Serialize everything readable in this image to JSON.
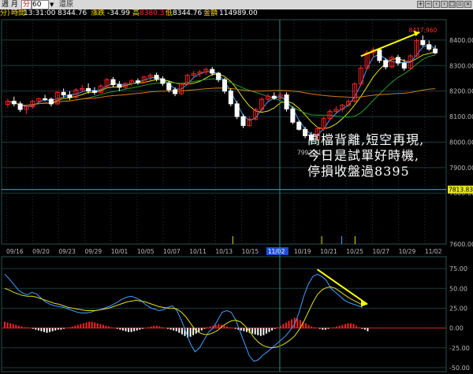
{
  "header": {
    "menu_label": "週 月",
    "period_tab": "分",
    "period_value": "60",
    "toolbar_extra": "還原",
    "row2_prefix": "分)",
    "time_label": "時間",
    "time_value": "13:31:00",
    "close_value": "8344.76",
    "change_label": "漲跌",
    "change_value": "-34.99",
    "high_label": "高",
    "high_value": "8380.3",
    "low_label": "低",
    "low_value": "8344.76",
    "amount_label": "金額",
    "amount_value": "114989.00"
  },
  "colors": {
    "up": "#ff2020",
    "down": "#ffffff",
    "ma_fast": "#3fa0ff",
    "ma_mid": "#e0e020",
    "ma_slow": "#2a9a2a",
    "ma_long": "#d07a20",
    "current_line": "#00d0d0",
    "hist_up": "#ff2020",
    "hist_down": "#ffffff",
    "macd_dif": "#3fa0ff",
    "macd_dea": "#e0e020",
    "arrow": "#ffff00",
    "grid": "#1e3a3a",
    "axis": "#bbbbbb"
  },
  "annotations": {
    "comment_lines": [
      "高檔背離,短空再現,",
      "今日是試單好時機,",
      "停損收盤過8395"
    ],
    "low_label": "7992.810",
    "high_label": "8417.960",
    "current_price_label": "7813.830"
  },
  "chart_data": [
    {
      "type": "candlestick",
      "name": "price",
      "ylim": [
        7600,
        8480
      ],
      "y_ticks": [
        "8400.00",
        "8300.00",
        "8200.00",
        "8100.00",
        "8000.00",
        "7900.00",
        "7800.00",
        "7600.00"
      ],
      "x_tick_labels": [
        "09/16",
        "09/20",
        "09/23",
        "09/29",
        "10/01",
        "10/05",
        "10/07",
        "10/11",
        "10/13",
        "10/15",
        "11/02",
        "10/19",
        "10/21",
        "10/25",
        "10/27",
        "10/29",
        "11/02"
      ],
      "highlighted_tick": "11/02",
      "candles": [
        [
          8148,
          8170,
          8135,
          8160
        ],
        [
          8160,
          8178,
          8140,
          8150
        ],
        [
          8150,
          8160,
          8118,
          8128
        ],
        [
          8128,
          8142,
          8110,
          8138
        ],
        [
          8138,
          8165,
          8130,
          8160
        ],
        [
          8160,
          8175,
          8150,
          8170
        ],
        [
          8170,
          8185,
          8160,
          8168
        ],
        [
          8168,
          8175,
          8140,
          8150
        ],
        [
          8150,
          8200,
          8145,
          8195
        ],
        [
          8195,
          8210,
          8175,
          8185
        ],
        [
          8185,
          8200,
          8165,
          8175
        ],
        [
          8175,
          8212,
          8170,
          8205
        ],
        [
          8205,
          8225,
          8195,
          8210
        ],
        [
          8210,
          8230,
          8190,
          8200
        ],
        [
          8200,
          8215,
          8185,
          8195
        ],
        [
          8195,
          8228,
          8190,
          8220
        ],
        [
          8220,
          8252,
          8210,
          8245
        ],
        [
          8245,
          8255,
          8215,
          8225
        ],
        [
          8225,
          8240,
          8200,
          8215
        ],
        [
          8215,
          8235,
          8205,
          8230
        ],
        [
          8230,
          8248,
          8220,
          8240
        ],
        [
          8240,
          8250,
          8225,
          8235
        ],
        [
          8235,
          8260,
          8230,
          8255
        ],
        [
          8255,
          8270,
          8240,
          8262
        ],
        [
          8262,
          8272,
          8238,
          8248
        ],
        [
          8248,
          8258,
          8220,
          8230
        ],
        [
          8230,
          8240,
          8195,
          8205
        ],
        [
          8205,
          8215,
          8180,
          8190
        ],
        [
          8190,
          8232,
          8185,
          8228
        ],
        [
          8228,
          8268,
          8222,
          8262
        ],
        [
          8262,
          8280,
          8250,
          8268
        ],
        [
          8268,
          8283,
          8255,
          8275
        ],
        [
          8275,
          8292,
          8265,
          8285
        ],
        [
          8285,
          8295,
          8260,
          8270
        ],
        [
          8270,
          8276,
          8235,
          8245
        ],
        [
          8245,
          8252,
          8190,
          8200
        ],
        [
          8200,
          8210,
          8140,
          8150
        ],
        [
          8150,
          8162,
          8090,
          8100
        ],
        [
          8100,
          8110,
          8055,
          8065
        ],
        [
          8065,
          8098,
          8060,
          8090
        ],
        [
          8090,
          8135,
          8085,
          8128
        ],
        [
          8128,
          8175,
          8120,
          8168
        ],
        [
          8168,
          8190,
          8160,
          8180
        ],
        [
          8180,
          8195,
          8165,
          8172
        ],
        [
          8172,
          8195,
          8168,
          8185
        ],
        [
          8185,
          8195,
          8120,
          8130
        ],
        [
          8130,
          8140,
          8070,
          8078
        ],
        [
          8078,
          8085,
          8045,
          8050
        ],
        [
          8050,
          8060,
          8015,
          8025
        ],
        [
          8025,
          8040,
          7993,
          8010
        ],
        [
          8010,
          8060,
          8005,
          8052
        ],
        [
          8052,
          8100,
          8045,
          8092
        ],
        [
          8092,
          8128,
          8085,
          8120
        ],
        [
          8120,
          8140,
          8110,
          8128
        ],
        [
          8128,
          8150,
          8118,
          8145
        ],
        [
          8145,
          8168,
          8138,
          8160
        ],
        [
          8160,
          8235,
          8155,
          8228
        ],
        [
          8228,
          8300,
          8220,
          8290
        ],
        [
          8290,
          8360,
          8282,
          8350
        ],
        [
          8350,
          8372,
          8330,
          8362
        ],
        [
          8362,
          8368,
          8310,
          8320
        ],
        [
          8320,
          8330,
          8285,
          8295
        ],
        [
          8295,
          8340,
          8288,
          8332
        ],
        [
          8332,
          8342,
          8300,
          8310
        ],
        [
          8310,
          8325,
          8280,
          8290
        ],
        [
          8290,
          8345,
          8285,
          8338
        ],
        [
          8338,
          8405,
          8332,
          8398
        ],
        [
          8398,
          8418,
          8375,
          8382
        ],
        [
          8382,
          8398,
          8358,
          8365
        ],
        [
          8365,
          8380,
          8344,
          8350
        ]
      ]
    },
    {
      "type": "bar+line",
      "name": "macd",
      "ylim": [
        -55,
        90
      ],
      "y_ticks": [
        "75.00",
        "50.00",
        "25.00",
        "0.00",
        "-25.00",
        "-50.00"
      ],
      "histogram": [
        8,
        7,
        6,
        5,
        4,
        3,
        2,
        1,
        1,
        0,
        -1,
        -2,
        -3,
        -4,
        -5,
        -6,
        -5,
        -4,
        -3,
        -2,
        -2,
        -1,
        0,
        1,
        2,
        3,
        4,
        5,
        6,
        7,
        8,
        8,
        7,
        6,
        5,
        4,
        3,
        2,
        1,
        0,
        -1,
        -2,
        -3,
        -4,
        -5,
        -5,
        -4,
        -3,
        -2,
        -1,
        0,
        1,
        2,
        3,
        3,
        2,
        1,
        0,
        -1,
        -2,
        -3,
        -4,
        -6,
        -8,
        -10,
        -12,
        -11,
        -9,
        -7,
        -5,
        -3,
        -1,
        1,
        2,
        3,
        4,
        5,
        4,
        3,
        2,
        1,
        0,
        -1,
        -2,
        -3,
        -4,
        -5,
        -6,
        -7,
        -8,
        -9,
        -10,
        -9,
        -7,
        -5,
        -3,
        -1,
        1,
        3,
        5,
        7,
        9,
        11,
        13,
        12,
        10,
        8,
        6,
        4,
        2,
        1,
        0,
        -1,
        -2,
        -2,
        -1,
        0,
        1,
        2,
        3,
        4,
        5,
        6,
        6,
        5,
        3,
        1,
        -1,
        -2,
        -4
      ],
      "dif": [
        68,
        62,
        55,
        48,
        44,
        42,
        45,
        43,
        38,
        33,
        30,
        28,
        27,
        26,
        24,
        22,
        20,
        19,
        19,
        20,
        22,
        23,
        25,
        27,
        30,
        33,
        37,
        39,
        40,
        38,
        35,
        30,
        26,
        24,
        22,
        23,
        26,
        28,
        22,
        10,
        -5,
        -20,
        -30,
        -25,
        -15,
        -5,
        0,
        10,
        20,
        22,
        20,
        10,
        -5,
        -20,
        -35,
        -42,
        -40,
        -34,
        -30,
        -25,
        -20,
        -15,
        -10,
        -3,
        5,
        20,
        40,
        55,
        65,
        68,
        65,
        60,
        50,
        45,
        40,
        35,
        32,
        30,
        28,
        26
      ],
      "dea": [
        50,
        48,
        45,
        43,
        41,
        40,
        40,
        39,
        37,
        35,
        33,
        31,
        30,
        28,
        26,
        25,
        24,
        23,
        22,
        22,
        22,
        23,
        24,
        25,
        27,
        29,
        31,
        33,
        34,
        35,
        34,
        33,
        31,
        29,
        27,
        26,
        25,
        25,
        24,
        20,
        14,
        6,
        -2,
        -6,
        -8,
        -8,
        -6,
        -3,
        2,
        6,
        9,
        10,
        8,
        3,
        -4,
        -12,
        -18,
        -22,
        -24,
        -25,
        -24,
        -22,
        -19,
        -15,
        -10,
        -2,
        8,
        20,
        32,
        42,
        48,
        51,
        52,
        50,
        46,
        42,
        38,
        35,
        32,
        29
      ]
    }
  ]
}
